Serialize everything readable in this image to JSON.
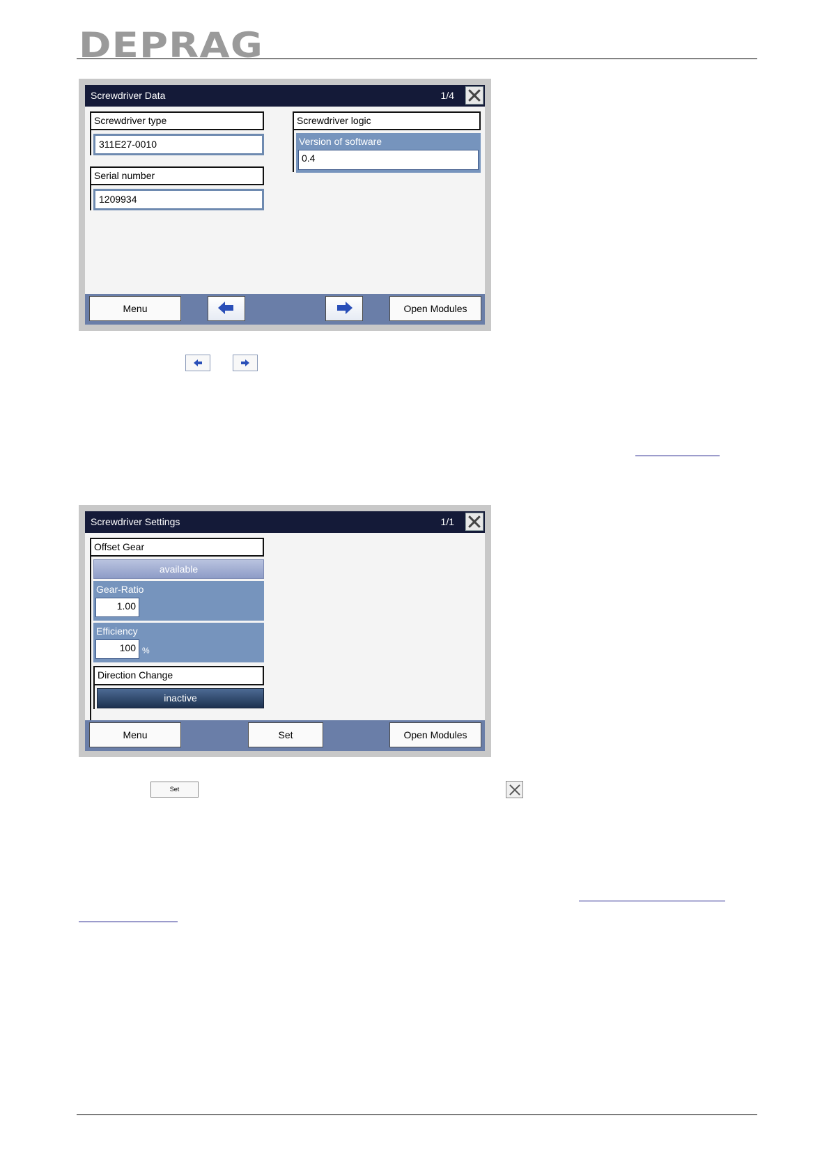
{
  "header": {
    "logo_text": "DEPRAG"
  },
  "screen_data": {
    "title": "Screwdriver Data",
    "page": "1/4",
    "type_label": "Screwdriver type",
    "type_value": "311E27-0010",
    "serial_label": "Serial number",
    "serial_value": "1209934",
    "logic_label": "Screwdriver logic",
    "software_label": "Version of software",
    "software_value": "0.4",
    "menu_label": "Menu",
    "open_modules_label": "Open Modules"
  },
  "screen_settings": {
    "title": "Screwdriver Settings",
    "page": "1/1",
    "offset_gear_label": "Offset Gear",
    "offset_gear_status": "available",
    "gear_ratio_label": "Gear-Ratio",
    "gear_ratio_value": "1.00",
    "efficiency_label": "Efficiency",
    "efficiency_value": "100",
    "efficiency_unit": "%",
    "direction_change_label": "Direction Change",
    "direction_change_status": "inactive",
    "menu_label": "Menu",
    "set_label": "Set",
    "open_modules_label": "Open Modules"
  },
  "inline_icons": {
    "set_label": "Set"
  },
  "icons": [
    "close-icon",
    "arrow-left-icon",
    "arrow-right-icon"
  ],
  "colors": {
    "titlebar": "#141a38",
    "toolbar": "#6a7ea8",
    "panel_blue": "#7694bd"
  }
}
